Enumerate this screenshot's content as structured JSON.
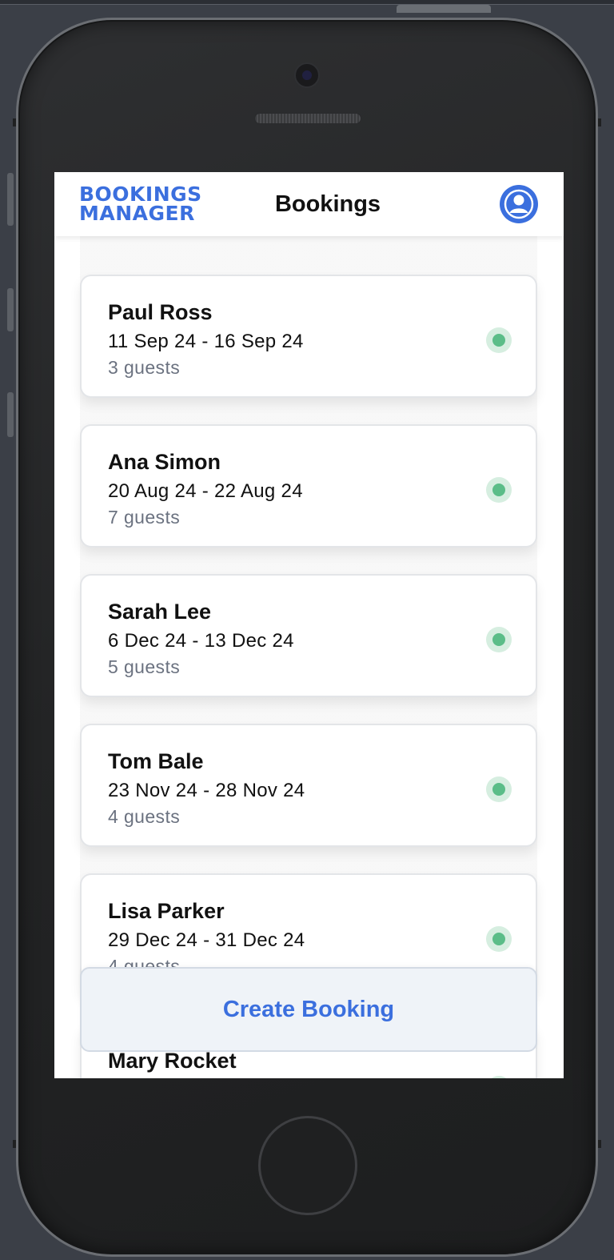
{
  "app": {
    "logo_line1": "BOOKINGS",
    "logo_line2": "MANAGER",
    "title": "Bookings",
    "accent_color": "#3b6fde",
    "status_color": "#5bbd88"
  },
  "header": {
    "avatar_icon": "user-avatar-icon"
  },
  "bookings": [
    {
      "name": "Paul Ross",
      "dates": "11 Sep 24 - 16 Sep 24",
      "guests": "3 guests",
      "status": "active"
    },
    {
      "name": "Ana Simon",
      "dates": "20 Aug 24 - 22 Aug 24",
      "guests": "7 guests",
      "status": "active"
    },
    {
      "name": "Sarah Lee",
      "dates": "6 Dec 24 - 13 Dec 24",
      "guests": "5 guests",
      "status": "active"
    },
    {
      "name": "Tom Bale",
      "dates": "23 Nov 24 - 28 Nov 24",
      "guests": "4 guests",
      "status": "active"
    },
    {
      "name": "Lisa Parker",
      "dates": "29 Dec 24 - 31 Dec 24",
      "guests": "4 guests",
      "status": "active"
    },
    {
      "name": "Mary Rocket",
      "dates": "",
      "guests": "",
      "status": "active"
    }
  ],
  "actions": {
    "create_label": "Create Booking"
  }
}
